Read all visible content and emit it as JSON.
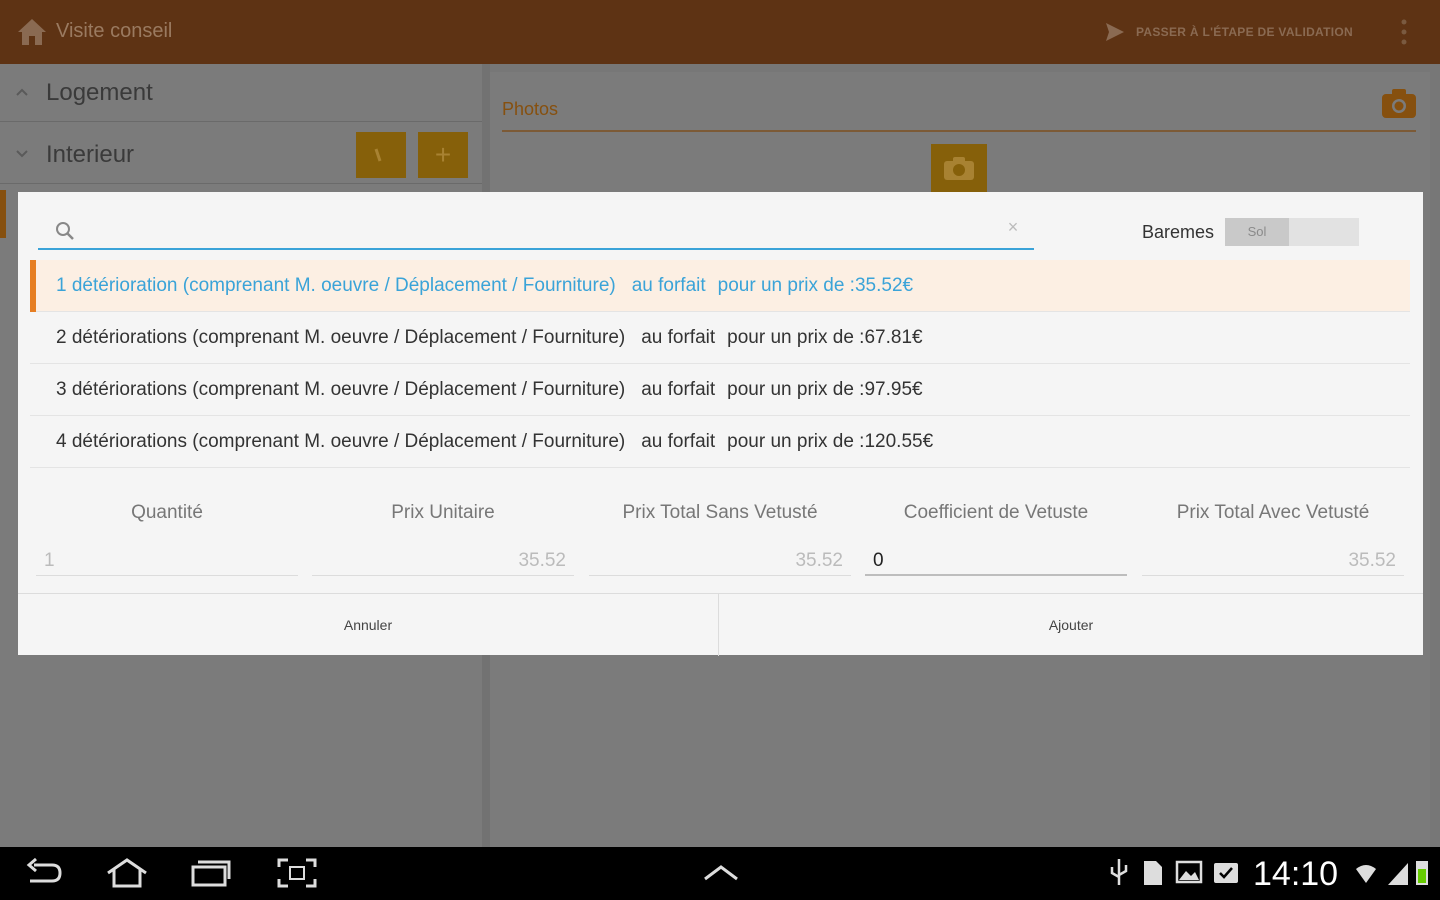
{
  "actionbar": {
    "title": "Visite conseil",
    "validate_label": "PASSER À L'ÉTAPE DE VALIDATION",
    "icons": [
      "home-icon",
      "send-icon",
      "overflow-menu-icon"
    ]
  },
  "background": {
    "sections": [
      {
        "label": "Logement",
        "state": "collapsed"
      },
      {
        "label": "Interieur",
        "state": "expanded"
      }
    ],
    "plus_label": "+",
    "photos_label": "Photos"
  },
  "dialog": {
    "search": {
      "value": "",
      "placeholder": ""
    },
    "baremes_label": "Baremes",
    "toggle_label": "Sol",
    "items": [
      {
        "desc": "1 détérioration (comprenant M. oeuvre / Déplacement / Fourniture)",
        "forfait": "au forfait",
        "price": "pour un prix de :35.52€",
        "selected": true
      },
      {
        "desc": "2 détériorations (comprenant M. oeuvre / Déplacement / Fourniture)",
        "forfait": "au forfait",
        "price": "pour un prix de :67.81€",
        "selected": false
      },
      {
        "desc": "3 détériorations (comprenant M. oeuvre / Déplacement / Fourniture)",
        "forfait": "au forfait",
        "price": "pour un prix de :97.95€",
        "selected": false
      },
      {
        "desc": "4 détériorations (comprenant M. oeuvre / Déplacement / Fourniture)",
        "forfait": "au forfait",
        "price": "pour un prix de :120.55€",
        "selected": false
      }
    ],
    "fields": [
      {
        "label": "Quantité",
        "value": "1"
      },
      {
        "label": "Prix Unitaire",
        "value": "35.52"
      },
      {
        "label": "Prix Total Sans Vetusté",
        "value": "35.52"
      },
      {
        "label": "Coefficient de Vetuste",
        "value": "0"
      },
      {
        "label": "Prix Total Avec Vetusté",
        "value": "35.52"
      }
    ],
    "cancel_label": "Annuler",
    "add_label": "Ajouter"
  },
  "statusbar": {
    "clock": "14:10"
  },
  "colors": {
    "actionbar": "#5e3314",
    "accent_blue": "#3aa3d8",
    "accent_orange": "#e67e22",
    "selected_bg": "#fcefe3"
  }
}
